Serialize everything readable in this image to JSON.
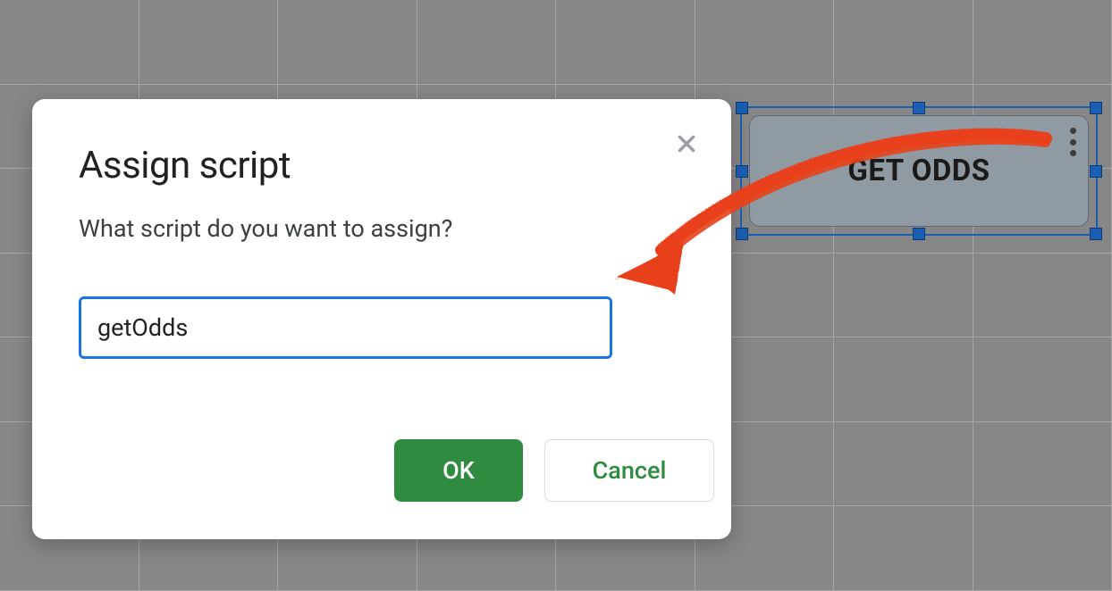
{
  "button_shape": {
    "label": "GET ODDS"
  },
  "dialog": {
    "title": "Assign script",
    "subtitle": "What script do you want to assign?",
    "input_value": "getOdds",
    "ok_label": "OK",
    "cancel_label": "Cancel"
  },
  "colors": {
    "primary_blue": "#1a73e8",
    "ok_green": "#2e8b3f",
    "annotation": "#e8411a"
  }
}
